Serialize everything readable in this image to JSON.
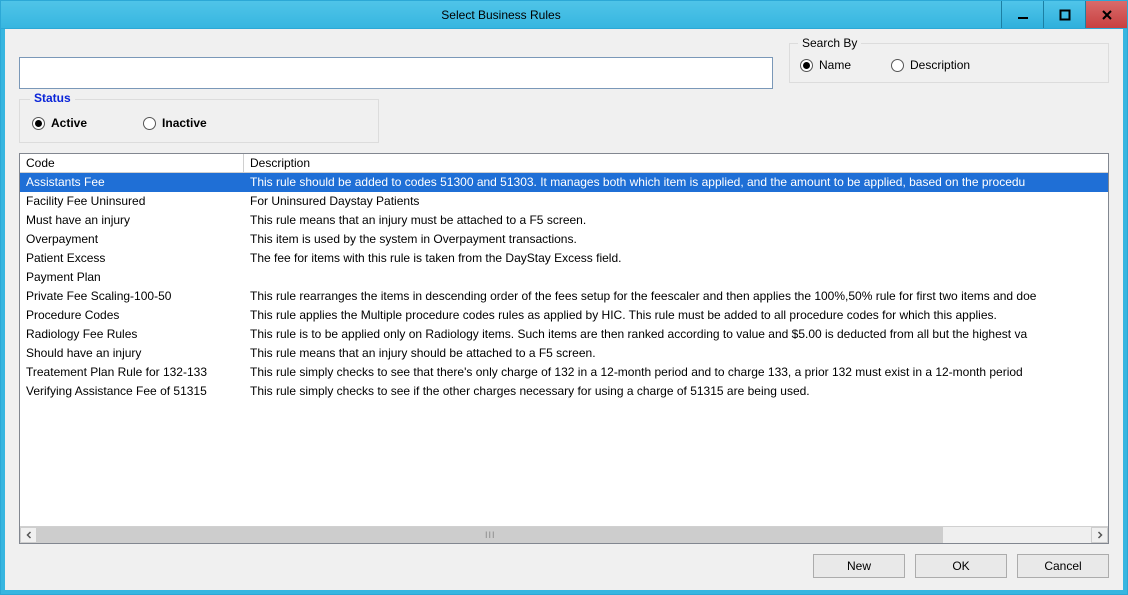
{
  "window": {
    "title": "Select Business Rules"
  },
  "search": {
    "value": "",
    "placeholder": ""
  },
  "searchby": {
    "label": "Search By",
    "options": [
      {
        "label": "Name",
        "checked": true
      },
      {
        "label": "Description",
        "checked": false
      }
    ]
  },
  "status": {
    "label": "Status",
    "options": [
      {
        "label": "Active",
        "checked": true
      },
      {
        "label": "Inactive",
        "checked": false
      }
    ]
  },
  "table": {
    "columns": {
      "code": "Code",
      "description": "Description"
    },
    "selected_index": 0,
    "rows": [
      {
        "code": "Assistants Fee",
        "description": "This rule should be added to codes 51300 and 51303. It manages both which item is applied, and the amount to be applied, based on the procedu"
      },
      {
        "code": "Facility Fee Uninsured",
        "description": "For Uninsured Daystay Patients"
      },
      {
        "code": "Must have an injury",
        "description": "This rule means that an injury must be attached to a F5 screen."
      },
      {
        "code": "Overpayment",
        "description": "This item is used by the system in Overpayment transactions."
      },
      {
        "code": "Patient Excess",
        "description": "The fee for items with this rule is taken from the DayStay Excess field."
      },
      {
        "code": "Payment Plan",
        "description": ""
      },
      {
        "code": "Private Fee Scaling-100-50",
        "description": "This rule rearranges the items in descending order of the fees setup for the feescaler and then applies the 100%,50% rule for first two items and doe"
      },
      {
        "code": "Procedure Codes",
        "description": "This rule applies the Multiple procedure codes rules as applied by HIC. This rule must be added to all procedure codes for which this applies."
      },
      {
        "code": "Radiology Fee Rules",
        "description": "This rule is to be applied only on Radiology items. Such items are then ranked according to value and $5.00 is deducted from all but the highest va"
      },
      {
        "code": "Should have an injury",
        "description": "This rule means that an injury should be attached to a F5 screen."
      },
      {
        "code": "Treatement Plan Rule for 132-133",
        "description": "This rule simply checks to see that there's only charge of 132 in a 12-month period  and  to charge 133, a prior 132 must exist in a 12-month period"
      },
      {
        "code": "Verifying Assistance Fee of 51315",
        "description": "This rule simply checks to see if the other charges necessary for using a charge of  51315 are being used."
      }
    ]
  },
  "buttons": {
    "new": "New",
    "ok": "OK",
    "cancel": "Cancel"
  }
}
